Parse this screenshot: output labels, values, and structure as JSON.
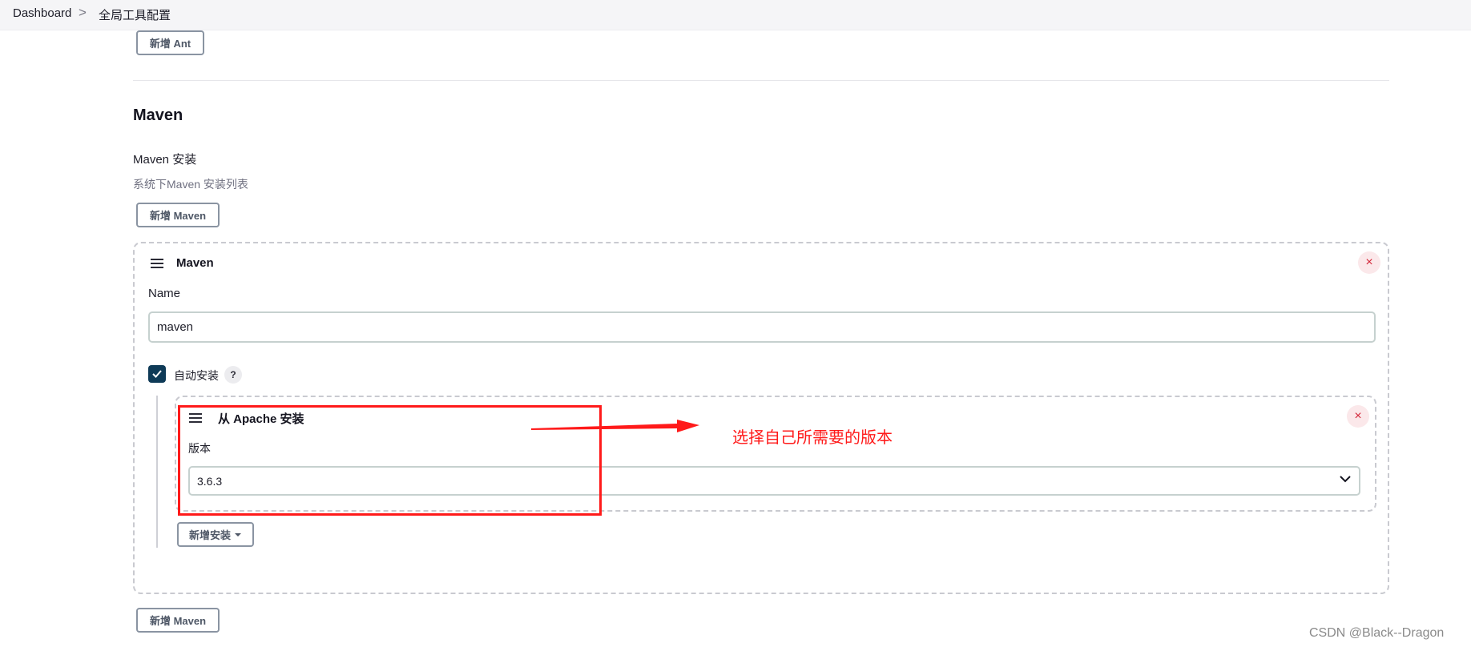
{
  "breadcrumb": {
    "items": [
      "Dashboard",
      "全局工具配置"
    ],
    "separator": ">"
  },
  "buttons": {
    "add_ant": "新增 Ant",
    "add_maven_top": "新增 Maven",
    "add_installer": "新增安装",
    "add_maven_bottom": "新增 Maven"
  },
  "maven_section": {
    "title": "Maven",
    "install_label": "Maven 安装",
    "install_desc": "系统下Maven 安装列表"
  },
  "maven_card": {
    "title": "Maven",
    "name_label": "Name",
    "name_value": "maven",
    "auto_install_label": "自动安装",
    "auto_install_checked": true,
    "help_label": "?",
    "close_label": "×"
  },
  "installer_card": {
    "title": "从 Apache 安装",
    "version_label": "版本",
    "version_value": "3.6.3",
    "close_label": "×"
  },
  "annotation": {
    "text": "选择自己所需要的版本",
    "color": "#ff1a1a"
  },
  "watermark": "CSDN @Black--Dragon",
  "colors": {
    "checkbox": "#0e3a57",
    "close_bg": "#fbe8ea",
    "close_fg": "#d3283a",
    "breadcrumb_bg": "#f5f5f7"
  },
  "icons": [
    "chevron-right-icon",
    "drag-handle-icon",
    "close-icon",
    "check-icon",
    "help-icon",
    "caret-down-icon",
    "chevron-down-icon"
  ]
}
